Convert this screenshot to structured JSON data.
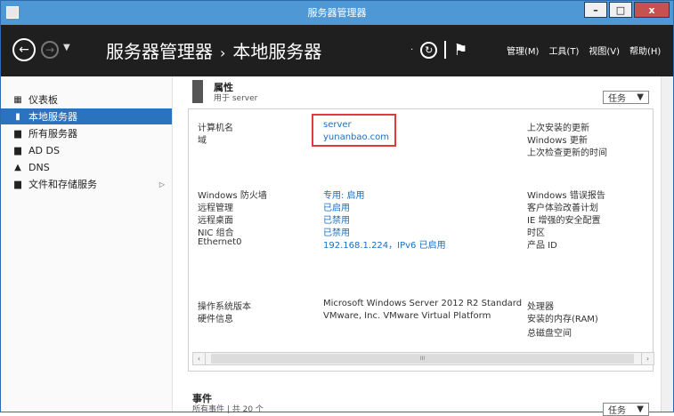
{
  "window": {
    "title": "服务器管理器",
    "min_glyph": "–",
    "max_glyph": "□",
    "close_glyph": "x"
  },
  "nav": {
    "back_glyph": "←",
    "forward_glyph": "→",
    "dropdown_glyph": "▼",
    "breadcrumb_root": "服务器管理器",
    "breadcrumb_sep": "›",
    "breadcrumb_current": "本地服务器",
    "refresh_dropdown": "·",
    "refresh_glyph": "↻"
  },
  "menu": {
    "manage": "管理(M)",
    "tools": "工具(T)",
    "view": "视图(V)",
    "help": "帮助(H)"
  },
  "sidebar": {
    "items": [
      {
        "label": "仪表板",
        "icon": "▦"
      },
      {
        "label": "本地服务器",
        "icon": "▮"
      },
      {
        "label": "所有服务器",
        "icon": "▆"
      },
      {
        "label": "AD DS",
        "icon": "▆"
      },
      {
        "label": "DNS",
        "icon": "▲"
      },
      {
        "label": "文件和存储服务",
        "icon": "▆",
        "expand_glyph": "▷"
      }
    ]
  },
  "properties": {
    "title": "属性",
    "subtitle": "用于 server",
    "tasks_label": "任务",
    "tasks_glyph": "▼"
  },
  "panel": {
    "computer_name_label": "计算机名",
    "computer_name_value": "server",
    "domain_label": "域",
    "domain_value": "yunanbao.com",
    "last_installed_updates": "上次安装的更新",
    "windows_update": "Windows 更新",
    "last_checked_updates": "上次检查更新的时间",
    "firewall_label": "Windows 防火墙",
    "firewall_value": "专用: 启用",
    "remote_mgmt_label": "远程管理",
    "remote_mgmt_value": "已启用",
    "remote_desktop_label": "远程桌面",
    "remote_desktop_value": "已禁用",
    "nic_label": "NIC 组合",
    "nic_value": "已禁用",
    "ethernet_label": "Ethernet0",
    "ethernet_value": "192.168.1.224，IPv6 已启用",
    "error_report": "Windows 错误报告",
    "ceip": "客户体验改善计划",
    "ie_security": "IE 增强的安全配置",
    "timezone": "时区",
    "product_id": "产品 ID",
    "os_label": "操作系统版本",
    "os_value": "Microsoft Windows Server 2012 R2 Standard",
    "hw_label": "硬件信息",
    "hw_value": "VMware, Inc. VMware Virtual Platform",
    "processor": "处理器",
    "ram": "安装的内存(RAM)",
    "disk": "总磁盘空间",
    "scroll_left": "‹",
    "scroll_right": "›",
    "scroll_thumb": "III"
  },
  "events": {
    "title": "事件",
    "subtitle": "所有事件 | 共 20 个",
    "tasks_label": "任务",
    "tasks_glyph": "▼"
  },
  "colors": {
    "titlebar": "#4f98d6",
    "navbar": "#1f1f1f",
    "active": "#2b73be",
    "link": "#1a6ebd",
    "highlight": "#e03a3a"
  }
}
